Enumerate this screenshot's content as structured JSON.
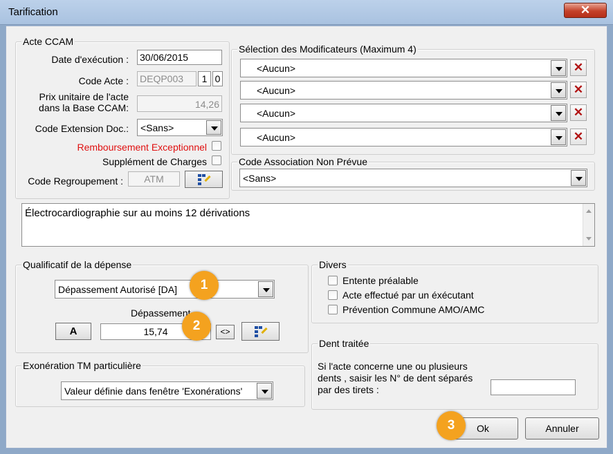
{
  "window": {
    "title": "Tarification",
    "close_glyph": "✕"
  },
  "acte": {
    "legend": "Acte CCAM",
    "date_label": "Date d'exécution :",
    "date_value": "30/06/2015",
    "code_label": "Code Acte :",
    "code_value": "DEQP003",
    "code_phase": "1",
    "code_activite": "0",
    "prix_label_1": "Prix unitaire de l'acte",
    "prix_label_2": "dans la Base CCAM:",
    "prix_value": "14,26",
    "ext_label": "Code Extension Doc.:",
    "ext_value": "<Sans>",
    "rembours_label": "Remboursement Exceptionnel",
    "rembours_color": "#e01010",
    "supplement_label": "Supplément de Charges",
    "regroup_label": "Code Regroupement :",
    "regroup_value": "ATM"
  },
  "modificateurs": {
    "legend": "Sélection des Modificateurs (Maximum 4)",
    "items": [
      "<Aucun>",
      "<Aucun>",
      "<Aucun>",
      "<Aucun>"
    ],
    "remove_glyph": "✕"
  },
  "association": {
    "legend": "Code Association Non Prévue",
    "value": "<Sans>"
  },
  "description": {
    "text": "Électrocardiographie sur au moins 12 dérivations"
  },
  "qualificatif": {
    "legend": "Qualificatif de la dépense",
    "value": "Dépassement Autorisé [DA]",
    "depassement_label": "Dépassement",
    "a_button": "A",
    "depassement_value": "15,74",
    "arrows_button": "<>"
  },
  "divers": {
    "legend": "Divers",
    "items": [
      "Entente préalable",
      "Acte effectué par un éxécutant",
      "Prévention Commune AMO/AMC"
    ]
  },
  "exoneration": {
    "legend": "Exonération TM particulière",
    "value": "Valeur définie dans fenêtre 'Exonérations'"
  },
  "dent": {
    "legend": "Dent traitée",
    "text_1": "Si l'acte concerne une ou plusieurs",
    "text_2": "dents , saisir les N° de dent séparés",
    "text_3": "par des tirets :",
    "value": ""
  },
  "buttons": {
    "ok": "Ok",
    "annuler": "Annuler"
  },
  "badges": [
    "1",
    "2",
    "3"
  ],
  "colors": {
    "badge": "#f4a21f",
    "title_bar": "#b5cbe6",
    "close_button": "#c4412a"
  }
}
